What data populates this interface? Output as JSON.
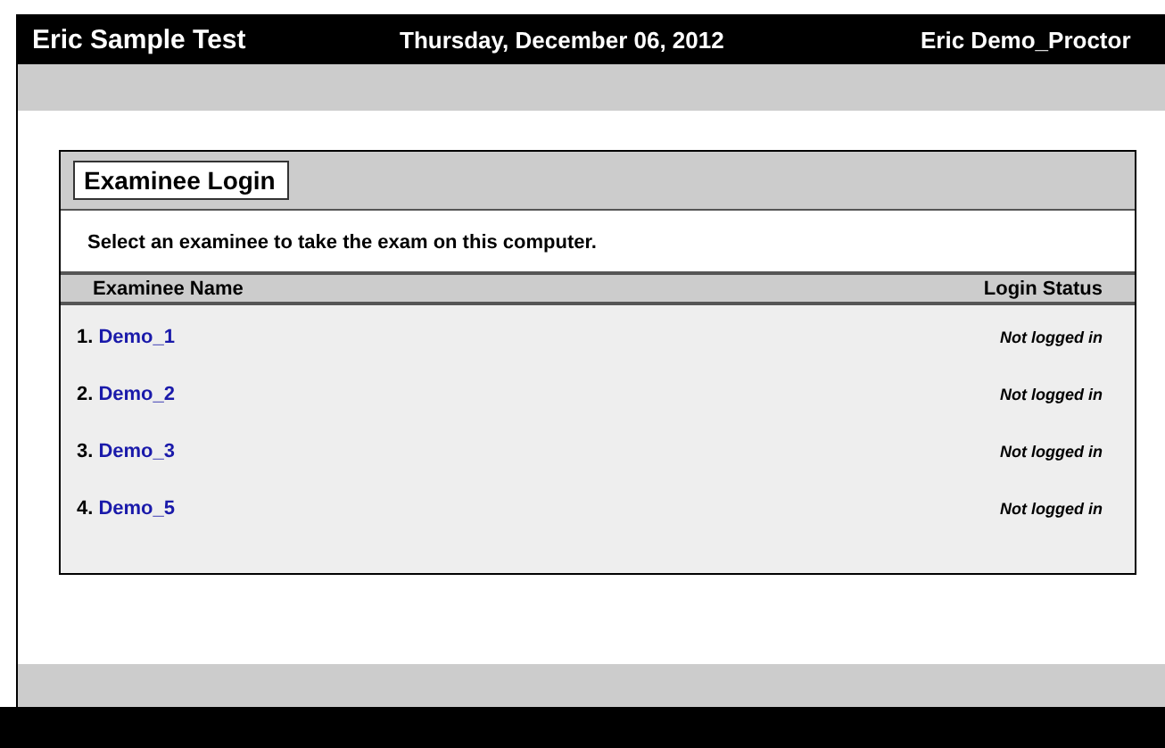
{
  "header": {
    "title": "Eric Sample Test",
    "date": "Thursday, December 06, 2012",
    "user": "Eric Demo_Proctor"
  },
  "panel": {
    "title": "Examinee Login",
    "instruction": "Select an examinee to take the exam on this computer.",
    "columns": [
      "Examinee Name",
      "Login Status"
    ],
    "rows": [
      {
        "number": "1.",
        "name": "Demo_1",
        "status": "Not logged in"
      },
      {
        "number": "2.",
        "name": "Demo_2",
        "status": "Not logged in"
      },
      {
        "number": "3.",
        "name": "Demo_3",
        "status": "Not logged in"
      },
      {
        "number": "4.",
        "name": "Demo_5",
        "status": "Not logged in"
      }
    ]
  }
}
